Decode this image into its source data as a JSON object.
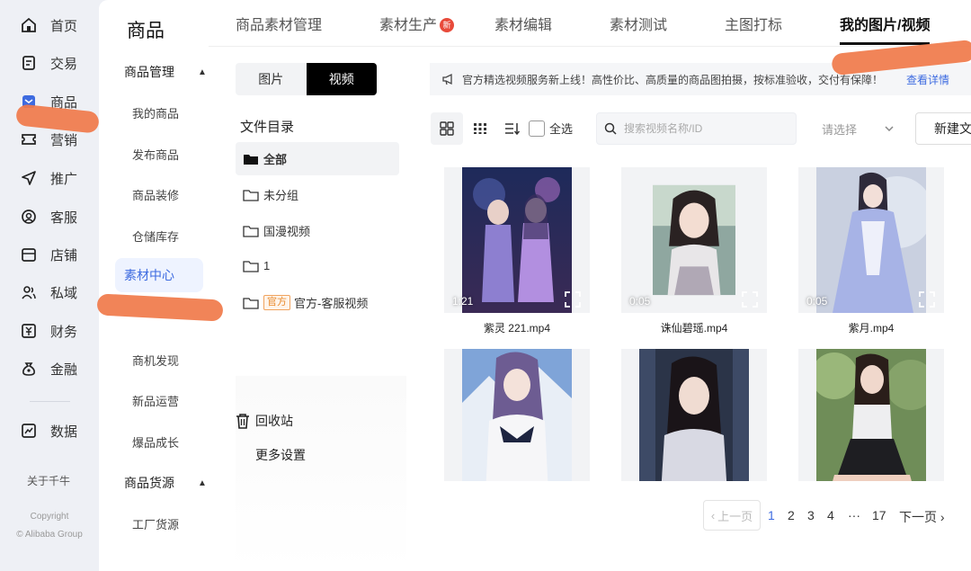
{
  "sidebar": {
    "items": [
      {
        "label": "首页",
        "icon": "home-icon"
      },
      {
        "label": "交易",
        "icon": "document-icon"
      },
      {
        "label": "商品",
        "icon": "product-icon"
      },
      {
        "label": "营销",
        "icon": "ticket-icon"
      },
      {
        "label": "推广",
        "icon": "send-icon"
      },
      {
        "label": "客服",
        "icon": "headset-icon"
      },
      {
        "label": "店铺",
        "icon": "store-icon"
      },
      {
        "label": "私域",
        "icon": "users-icon"
      },
      {
        "label": "财务",
        "icon": "finance-icon"
      },
      {
        "label": "金融",
        "icon": "money-bag-icon"
      },
      {
        "label": "数据",
        "icon": "chart-icon"
      }
    ],
    "about": "关于千牛",
    "copyright_line1": "Copyright",
    "copyright_line2": "© Alibaba Group"
  },
  "menu": {
    "title": "商品",
    "group1": "商品管理",
    "items1": [
      "我的商品",
      "发布商品",
      "商品装修",
      "仓储库存",
      "素材中心"
    ],
    "items2": [
      "商机发现",
      "新品运营",
      "爆品成长"
    ],
    "group2": "商品货源",
    "items3": [
      "工厂货源"
    ]
  },
  "tabs": [
    "商品素材管理",
    "素材生产",
    "素材编辑",
    "素材测试",
    "主图打标",
    "我的图片/视频"
  ],
  "new_badge": "新",
  "segment": {
    "image": "图片",
    "video": "视频"
  },
  "folders": {
    "title": "文件目录",
    "list": [
      "全部",
      "未分组",
      "国漫视频",
      "1",
      "官方-客服视频"
    ],
    "official_tag": "官方",
    "recycle": "回收站",
    "more_settings": "更多设置"
  },
  "notice": {
    "text": "官方精选视频服务新上线！高性价比、高质量的商品图拍摄，按标准验收，交付有保障！",
    "link": "查看详情"
  },
  "toolbar": {
    "select_all": "全选",
    "search_placeholder": "搜索视频名称/ID",
    "select_placeholder": "请选择",
    "new_button": "新建文件夹"
  },
  "videos": [
    {
      "name": "紫灵 221.mp4",
      "duration": "1:21"
    },
    {
      "name": "诛仙碧瑶.mp4",
      "duration": "0:05"
    },
    {
      "name": "紫月.mp4",
      "duration": "0:05"
    },
    {
      "name": "",
      "duration": ""
    },
    {
      "name": "",
      "duration": ""
    },
    {
      "name": "",
      "duration": ""
    }
  ],
  "pagination": {
    "prev": "上一页",
    "pages": [
      "1",
      "2",
      "3",
      "4",
      "···",
      "17"
    ],
    "next": "下一页",
    "current": "1"
  }
}
